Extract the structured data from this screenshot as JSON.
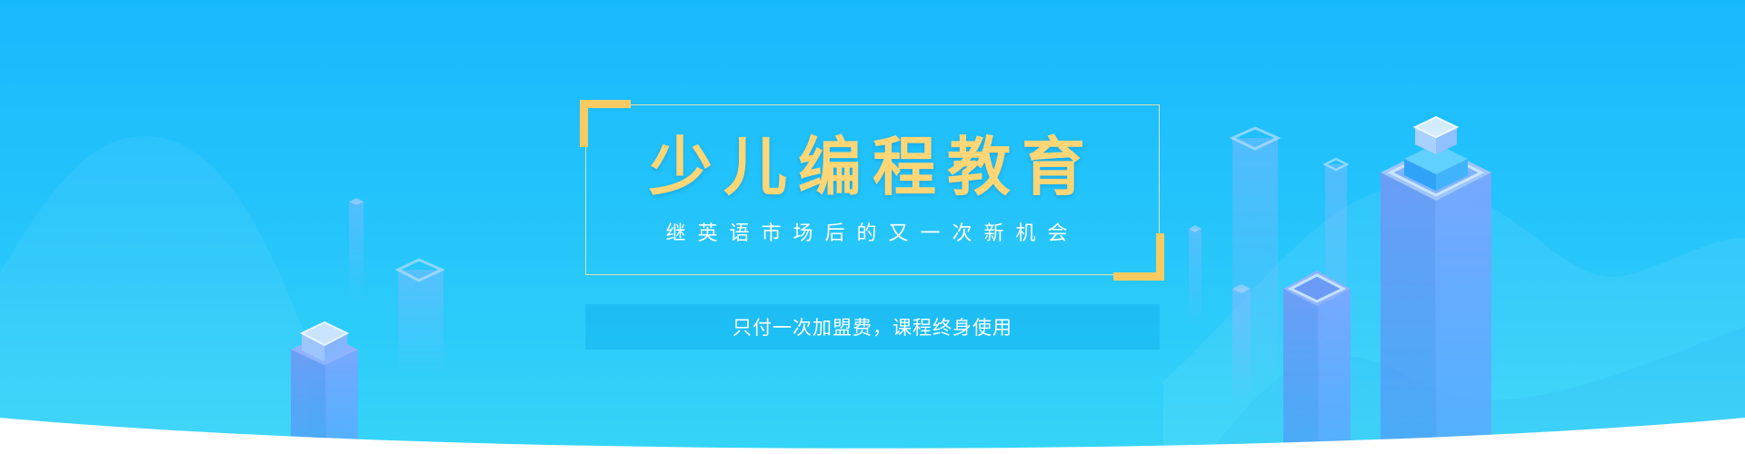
{
  "banner": {
    "title": "少儿编程教育",
    "subtitle": "继英语市场后的又一次新机会",
    "tagline": "只付一次加盟费，课程终身使用"
  },
  "colors": {
    "background_top": "#17b9fd",
    "background_bottom": "#35d5f8",
    "title": "#ffd675",
    "accent_corner": "#f8cb62",
    "text": "#ffffff",
    "tower": "#6aa8ff"
  }
}
